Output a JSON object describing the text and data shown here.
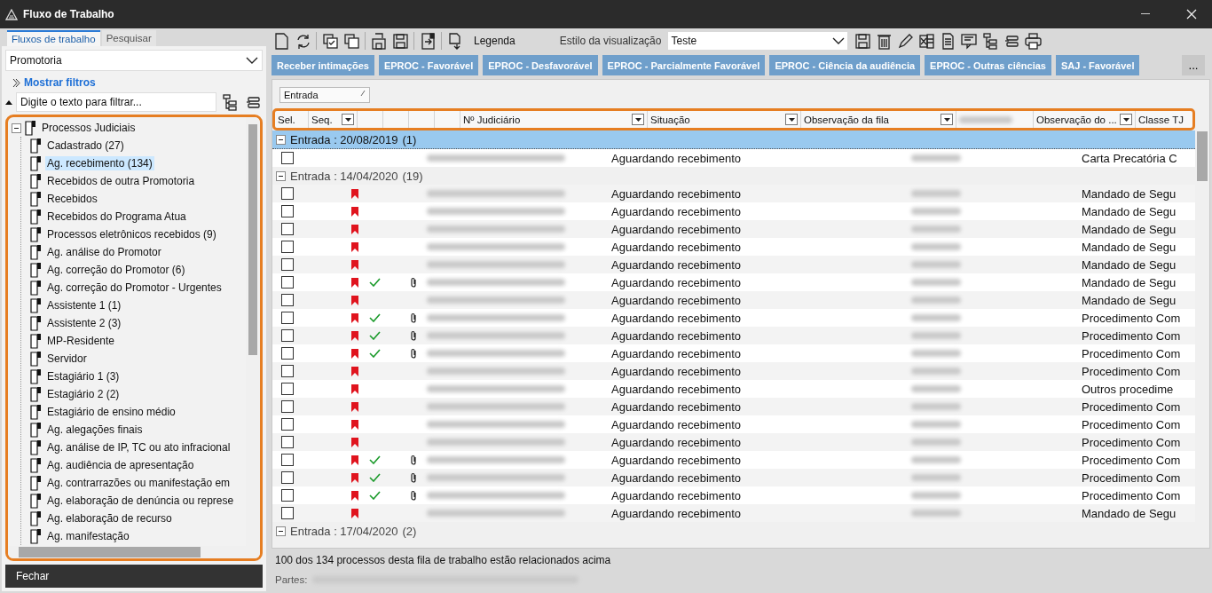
{
  "window": {
    "title": "Fluxo de Trabalho"
  },
  "sidebar": {
    "tabs": [
      {
        "label": "Fluxos de trabalho",
        "selected": true
      },
      {
        "label": "Pesquisar",
        "selected": false
      }
    ],
    "dropdown": {
      "value": "Promotoria"
    },
    "filters_link": "Mostrar filtros",
    "filter": {
      "placeholder": "Digite o texto para filtrar..."
    },
    "tree": [
      {
        "label": "Processos Judiciais",
        "expanded": true,
        "selected": false,
        "children": [
          {
            "label": "Cadastrado (27)",
            "selected": false
          },
          {
            "label": "Ag. recebimento (134)",
            "selected": true
          },
          {
            "label": "Recebidos de outra Promotoria",
            "selected": false
          },
          {
            "label": "Recebidos",
            "selected": false
          },
          {
            "label": "Recebidos do Programa Atua",
            "selected": false
          },
          {
            "label": "Processos eletrônicos recebidos (9)",
            "selected": false
          },
          {
            "label": "Ag. análise do Promotor",
            "selected": false
          },
          {
            "label": "Ag. correção do Promotor (6)",
            "selected": false
          },
          {
            "label": "Ag. correção do Promotor - Urgentes",
            "selected": false
          },
          {
            "label": "Assistente 1 (1)",
            "selected": false
          },
          {
            "label": "Assistente 2 (3)",
            "selected": false
          },
          {
            "label": "MP-Residente",
            "selected": false
          },
          {
            "label": "Servidor",
            "selected": false
          },
          {
            "label": "Estagiário 1 (3)",
            "selected": false
          },
          {
            "label": "Estagiário 2 (2)",
            "selected": false
          },
          {
            "label": "Estagiário de ensino médio",
            "selected": false
          },
          {
            "label": "Ag. alegações finais",
            "selected": false
          },
          {
            "label": "Ag. análise de IP, TC ou ato infracional",
            "selected": false
          },
          {
            "label": "Ag. audiência de apresentação",
            "selected": false
          },
          {
            "label": "Ag. contrarrazões ou manifestação em",
            "selected": false
          },
          {
            "label": "Ag. elaboração de denúncia ou represe",
            "selected": false
          },
          {
            "label": "Ag. elaboração de recurso",
            "selected": false
          },
          {
            "label": "Ag. manifestação",
            "selected": false
          }
        ]
      }
    ],
    "close_button": "Fechar"
  },
  "toolbar": {
    "legend": "Legenda",
    "view_style_label": "Estilo da visualização",
    "view_style": "Teste"
  },
  "action_buttons": [
    "Receber intimações",
    "EPROC - Favorável",
    "EPROC - Desfavorável",
    "EPROC - Parcialmente Favorável",
    "EPROC - Ciência da audiência",
    "EPROC - Outras ciências",
    "SAJ - Favorável"
  ],
  "more_button": "...",
  "group_by": "Entrada",
  "table": {
    "columns": [
      {
        "kind": "select",
        "label": "Sel."
      },
      {
        "kind": "seq",
        "label": "Seq."
      },
      {
        "kind": "flag"
      },
      {
        "kind": "check"
      },
      {
        "kind": "blank"
      },
      {
        "kind": "clip"
      },
      {
        "kind": "number",
        "label": "Nº Judiciário"
      },
      {
        "kind": "status",
        "label": "Situação"
      },
      {
        "kind": "note",
        "label": "Observação da fila"
      },
      {
        "kind": "blurred"
      },
      {
        "kind": "note",
        "label": "Observação do ..."
      },
      {
        "kind": "class",
        "label": "Classe TJ"
      }
    ],
    "groups": [
      {
        "label": "Entrada : 20/08/2019",
        "count": "(1)",
        "expanded": true,
        "selected": true,
        "rows": [
          {
            "checked": false,
            "flagged": false,
            "done": false,
            "attachment": false,
            "status": "Aguardando recebimento",
            "class": "Carta Precatória C"
          }
        ]
      },
      {
        "label": "Entrada : 14/04/2020",
        "count": "(19)",
        "expanded": true,
        "selected": false,
        "rows": [
          {
            "checked": false,
            "flagged": true,
            "done": false,
            "attachment": false,
            "status": "Aguardando recebimento",
            "class": "Mandado de Segu"
          },
          {
            "checked": false,
            "flagged": true,
            "done": false,
            "attachment": false,
            "status": "Aguardando recebimento",
            "class": "Mandado de Segu"
          },
          {
            "checked": false,
            "flagged": true,
            "done": false,
            "attachment": false,
            "status": "Aguardando recebimento",
            "class": "Mandado de Segu"
          },
          {
            "checked": false,
            "flagged": true,
            "done": false,
            "attachment": false,
            "status": "Aguardando recebimento",
            "class": "Mandado de Segu"
          },
          {
            "checked": false,
            "flagged": true,
            "done": false,
            "attachment": false,
            "status": "Aguardando recebimento",
            "class": "Mandado de Segu"
          },
          {
            "checked": false,
            "flagged": true,
            "done": true,
            "attachment": true,
            "status": "Aguardando recebimento",
            "class": "Mandado de Segu"
          },
          {
            "checked": false,
            "flagged": true,
            "done": false,
            "attachment": false,
            "status": "Aguardando recebimento",
            "class": "Mandado de Segu"
          },
          {
            "checked": false,
            "flagged": true,
            "done": true,
            "attachment": true,
            "status": "Aguardando recebimento",
            "class": "Procedimento Com"
          },
          {
            "checked": false,
            "flagged": true,
            "done": true,
            "attachment": true,
            "status": "Aguardando recebimento",
            "class": "Procedimento Com"
          },
          {
            "checked": false,
            "flagged": true,
            "done": true,
            "attachment": true,
            "status": "Aguardando recebimento",
            "class": "Procedimento Com"
          },
          {
            "checked": false,
            "flagged": true,
            "done": false,
            "attachment": false,
            "status": "Aguardando recebimento",
            "class": "Procedimento Com"
          },
          {
            "checked": false,
            "flagged": true,
            "done": false,
            "attachment": false,
            "status": "Aguardando recebimento",
            "class": "Outros procedime"
          },
          {
            "checked": false,
            "flagged": true,
            "done": false,
            "attachment": false,
            "status": "Aguardando recebimento",
            "class": "Procedimento Com"
          },
          {
            "checked": false,
            "flagged": true,
            "done": false,
            "attachment": false,
            "status": "Aguardando recebimento",
            "class": "Procedimento Com"
          },
          {
            "checked": false,
            "flagged": true,
            "done": false,
            "attachment": false,
            "status": "Aguardando recebimento",
            "class": "Procedimento Com"
          },
          {
            "checked": false,
            "flagged": true,
            "done": true,
            "attachment": true,
            "status": "Aguardando recebimento",
            "class": "Procedimento Com"
          },
          {
            "checked": false,
            "flagged": true,
            "done": true,
            "attachment": true,
            "status": "Aguardando recebimento",
            "class": "Procedimento Com"
          },
          {
            "checked": false,
            "flagged": true,
            "done": true,
            "attachment": true,
            "status": "Aguardando recebimento",
            "class": "Procedimento Com"
          },
          {
            "checked": false,
            "flagged": true,
            "done": false,
            "attachment": false,
            "status": "Aguardando recebimento",
            "class": "Mandado de Segu"
          }
        ]
      },
      {
        "label": "Entrada : 17/04/2020",
        "count": "(2)",
        "expanded": true,
        "selected": false
      }
    ]
  },
  "status_bar": {
    "summary": "100 dos 134 processos desta fila de trabalho estão relacionados acima",
    "parts_label": "Partes:"
  }
}
